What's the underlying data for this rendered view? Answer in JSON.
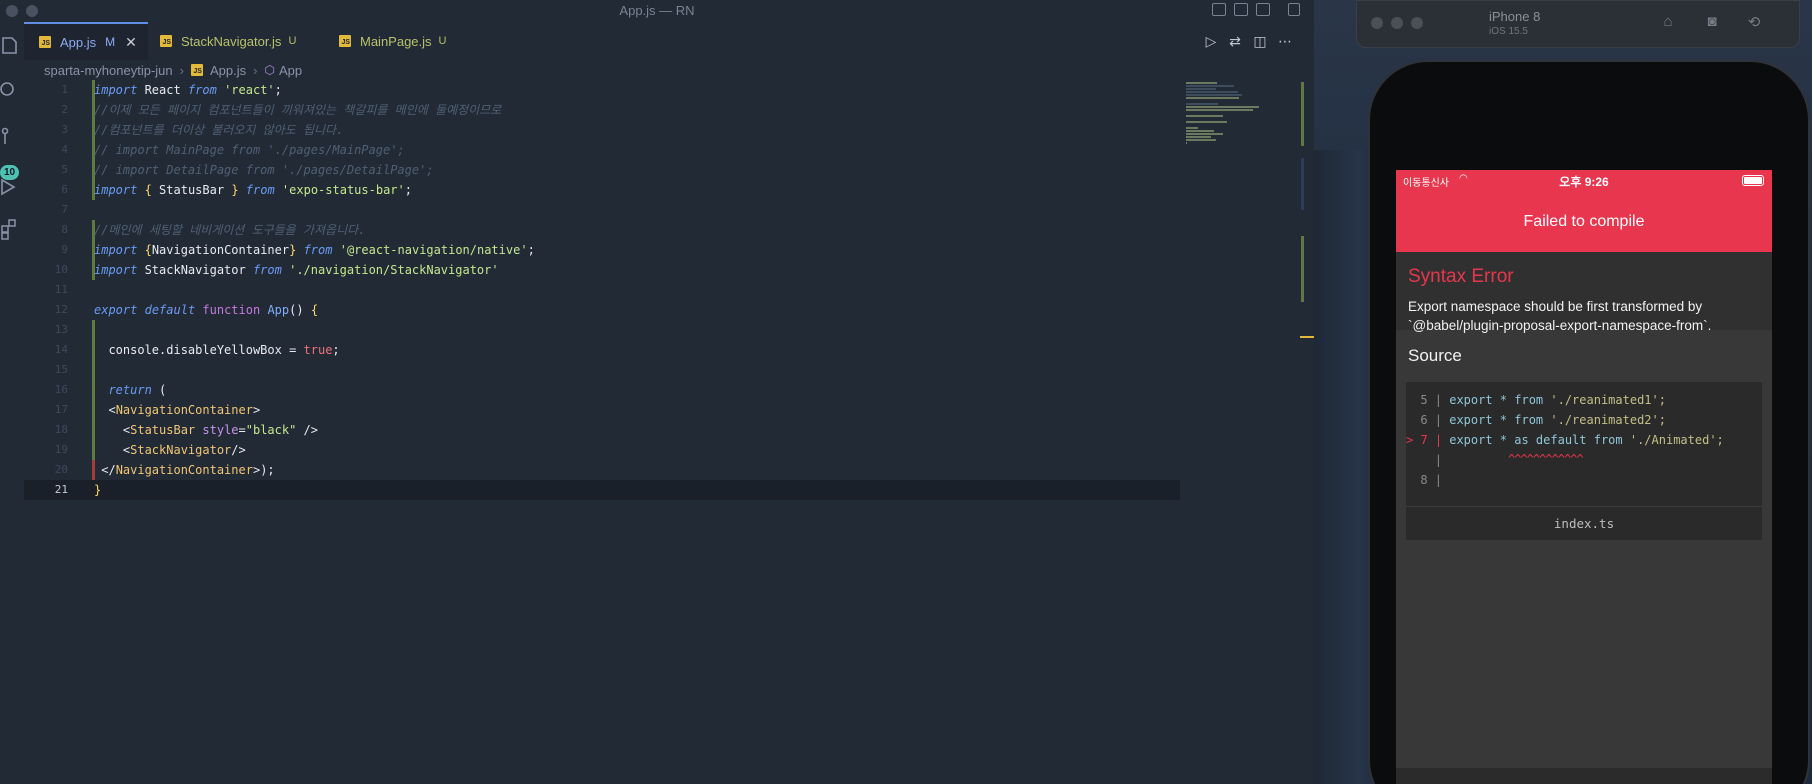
{
  "editor": {
    "window_title": "App.js — RN",
    "tabs": [
      {
        "name": "App.js",
        "status": "M",
        "active": true
      },
      {
        "name": "StackNavigator.js",
        "status": "U",
        "active": false
      },
      {
        "name": "MainPage.js",
        "status": "U",
        "active": false
      }
    ],
    "scm_badge": "10",
    "breadcrumb": {
      "folder": "sparta-myhoneytip-jun",
      "file": "App.js",
      "symbol": "App"
    },
    "current_line": 21,
    "code_lines": [
      {
        "n": "1",
        "text": "import React from 'react';"
      },
      {
        "n": "2",
        "text": "//이제 모든 페이지 컴포넌트들이 끼워져있는 책갈피를 메인에 둘예정이므로"
      },
      {
        "n": "3",
        "text": "//컴포넌트를 더이상 불러오지 않아도 됩니다."
      },
      {
        "n": "4",
        "text": "// import MainPage from './pages/MainPage';"
      },
      {
        "n": "5",
        "text": "// import DetailPage from './pages/DetailPage';"
      },
      {
        "n": "6",
        "text": "import { StatusBar } from 'expo-status-bar';"
      },
      {
        "n": "7",
        "text": ""
      },
      {
        "n": "8",
        "text": "//메인에 세팅할 네비게이션 도구들을 가져옵니다."
      },
      {
        "n": "9",
        "text": "import {NavigationContainer} from '@react-navigation/native';"
      },
      {
        "n": "10",
        "text": "import StackNavigator from './navigation/StackNavigator'"
      },
      {
        "n": "11",
        "text": ""
      },
      {
        "n": "12",
        "text": "export default function App() {"
      },
      {
        "n": "13",
        "text": ""
      },
      {
        "n": "14",
        "text": "  console.disableYellowBox = true;"
      },
      {
        "n": "15",
        "text": ""
      },
      {
        "n": "16",
        "text": "  return ("
      },
      {
        "n": "17",
        "text": "  <NavigationContainer>"
      },
      {
        "n": "18",
        "text": "    <StatusBar style=\"black\" />"
      },
      {
        "n": "19",
        "text": "    <StackNavigator/>"
      },
      {
        "n": "20",
        "text": " </NavigationContainer>);"
      },
      {
        "n": "21",
        "text": "}"
      }
    ]
  },
  "simulator": {
    "device": "iPhone 8",
    "os": "iOS 15.5",
    "status_bar": {
      "carrier": "이동통신사",
      "time": "오후 9:26"
    },
    "header": "Failed to compile",
    "error_title": "Syntax Error",
    "error_message": "Export namespace should be first transformed by `@babel/plugin-proposal-export-namespace-from`.",
    "source_title": "Source",
    "source_lines": [
      {
        "marker": "5 |",
        "code": "export * from ",
        "str": "'./reanimated1';"
      },
      {
        "marker": "6 |",
        "code": "export * from ",
        "str": "'./reanimated2';"
      },
      {
        "marker": "> 7 |",
        "code": "export * as default from ",
        "str": "'./Animated';"
      },
      {
        "marker": "|",
        "code": "",
        "str": ""
      },
      {
        "marker": "8 |",
        "code": "",
        "str": ""
      }
    ],
    "carets": "^^^^^^^^^^^^",
    "source_file": "index.ts"
  },
  "colors": {
    "accent_red": "#e8364e",
    "tab_active": "#5f8ee6",
    "badge": "#4fc1b0"
  }
}
